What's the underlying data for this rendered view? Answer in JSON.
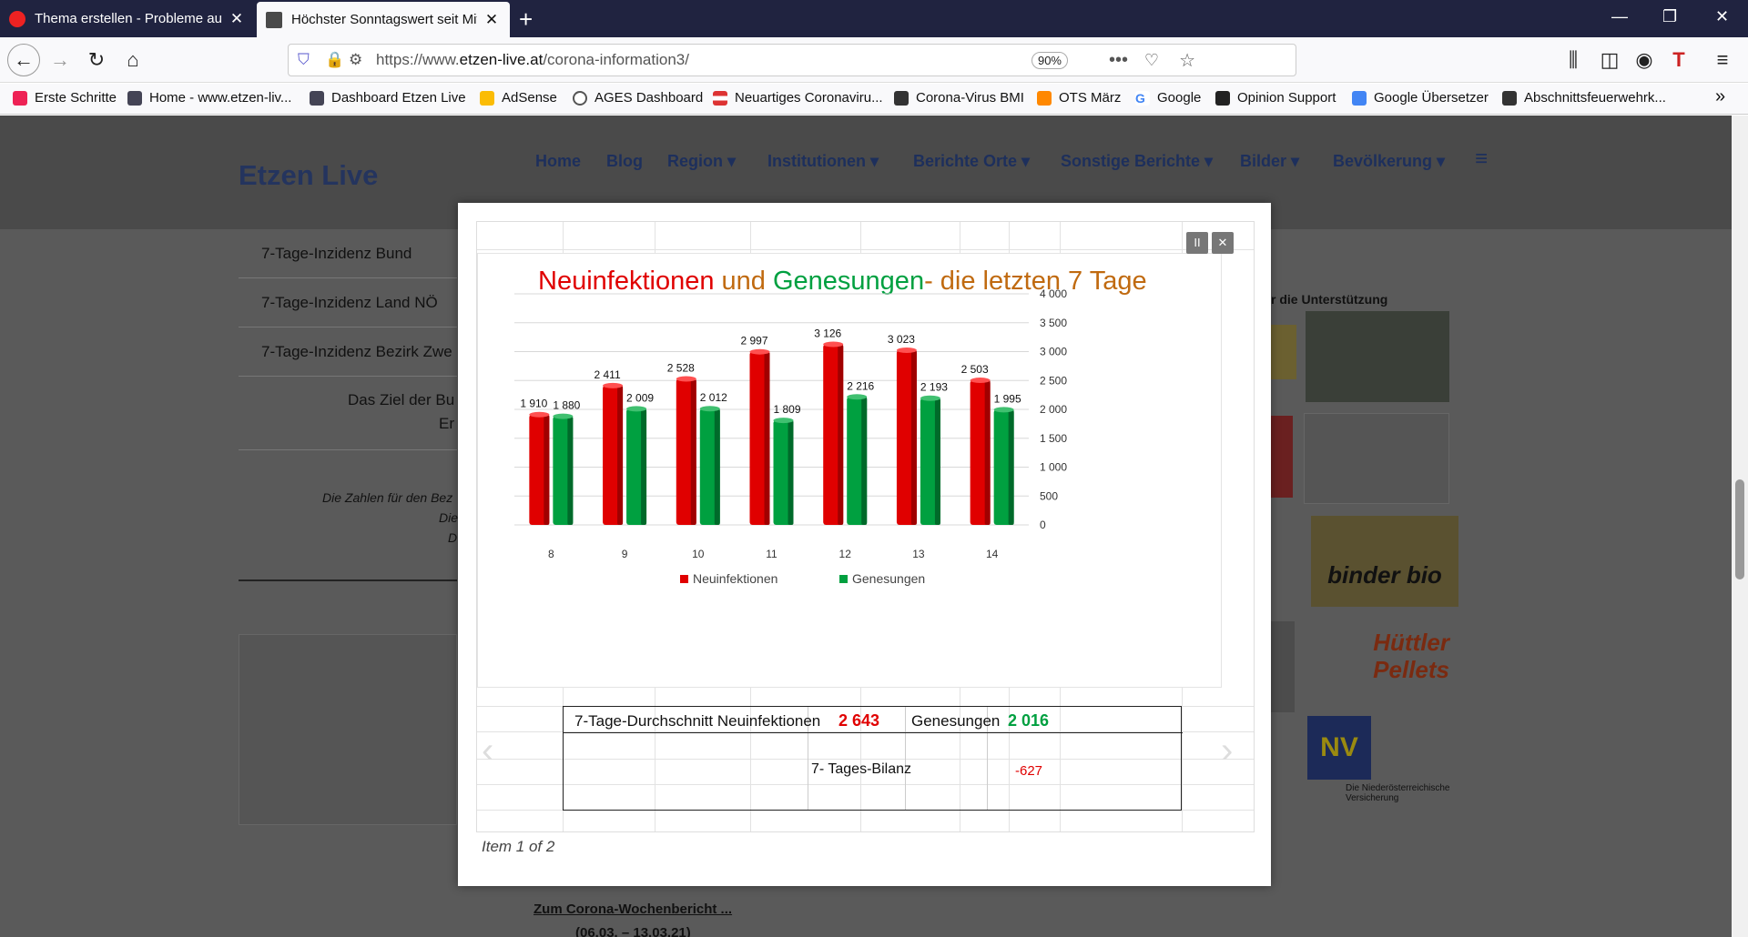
{
  "browser": {
    "tabs": [
      {
        "title": "Thema erstellen - Probleme auf",
        "favicon_color": "#e22"
      },
      {
        "title": "Höchster Sonntagswert seit Mit",
        "favicon_color": "#4a4a4a"
      }
    ],
    "new_tab_icon": "+",
    "window_controls": {
      "minimize": "—",
      "restore": "❐",
      "close": "✕"
    },
    "url_prefix": "https://www.",
    "url_domain": "etzen-live.at",
    "url_path": "/corona-information3/",
    "zoom": "90%",
    "bookmarks": [
      {
        "label": "Erste Schritte",
        "color": "#e25"
      },
      {
        "label": "Home - www.etzen-liv...",
        "color": "#445"
      },
      {
        "label": "Dashboard Etzen Live",
        "color": "#445"
      },
      {
        "label": "AdSense",
        "color": "#fbbc05"
      },
      {
        "label": "AGES Dashboard",
        "color": "#555"
      },
      {
        "label": "Neuartiges Coronaviru...",
        "color": "#d33"
      },
      {
        "label": "Corona-Virus BMI",
        "color": "#333"
      },
      {
        "label": "OTS März",
        "color": "#f80"
      },
      {
        "label": "Google",
        "color": "#4285f4"
      },
      {
        "label": "Opinion Support",
        "color": "#222"
      },
      {
        "label": "Google Übersetzer",
        "color": "#4285f4"
      },
      {
        "label": "Abschnittsfeuerwehrk...",
        "color": "#333"
      }
    ],
    "overflow_icon": "»"
  },
  "site": {
    "logo": "Etzen Live",
    "menu": [
      "Home",
      "Blog",
      "Region ▾",
      "Institutionen ▾",
      "Berichte Orte ▾",
      "Sonstige Berichte ▾",
      "Bilder ▾",
      "Bevölkerung ▾",
      "≡"
    ],
    "sidebar": [
      "7-Tage-Inzidenz Bund",
      "7-Tage-Inzidenz Land NÖ",
      "7-Tage-Inzidenz Bezirk Zwe"
    ],
    "sidebar_text": "Das Ziel der Bu",
    "sidebar_text2": "Er",
    "italic_note": "Die Zahlen für den Bez",
    "italic_note2": "Die",
    "italic_note3": "D",
    "right_heading": "r die Unterstützung",
    "ad_binder": "binder bio",
    "ad_huettler": "Hüttler Pellets",
    "ad_nv": "NV",
    "ad_nv_caption": "Die Niederösterreichische Versicherung",
    "below_link": "Zum Corona-Wochenbericht ...",
    "below_link2": "(06.03. – 13.03.21)"
  },
  "lightbox": {
    "pause_icon": "II",
    "close_icon": "✕",
    "item_count": "Item 1 of 2",
    "summary": {
      "avg_label": "7-Tage-Durchschnitt Neuinfektionen",
      "avg_value": "2 643",
      "recovered_label": "Genesungen",
      "recovered_value": "2 016",
      "balance_label": "7- Tages-Bilanz",
      "balance_value": "-627"
    }
  },
  "chart_data": {
    "type": "bar",
    "title_parts": [
      "Neuinfektionen",
      " und ",
      "Genesungen",
      "- die letzten 7 Tage"
    ],
    "categories": [
      "8",
      "9",
      "10",
      "11",
      "12",
      "13",
      "14"
    ],
    "series": [
      {
        "name": "Neuinfektionen",
        "color": "#e00000",
        "values": [
          1910,
          2411,
          2528,
          2997,
          3126,
          3023,
          2503
        ],
        "labels": [
          "1 910",
          "2 411",
          "2 528",
          "2 997",
          "3 126",
          "3 023",
          "2 503"
        ]
      },
      {
        "name": "Genesungen",
        "color": "#00a040",
        "values": [
          1880,
          2009,
          2012,
          1809,
          2216,
          2193,
          1995
        ],
        "labels": [
          "1 880",
          "2 009",
          "2 012",
          "1 809",
          "2 216",
          "2 193",
          "1 995"
        ]
      }
    ],
    "yticks": [
      "0",
      "500",
      "1 000",
      "1 500",
      "2 000",
      "2 500",
      "3 000",
      "3 500",
      "4 000"
    ],
    "ylim": [
      0,
      4000
    ],
    "yaxis_position": "right",
    "legend_position": "bottom",
    "grid": true
  }
}
